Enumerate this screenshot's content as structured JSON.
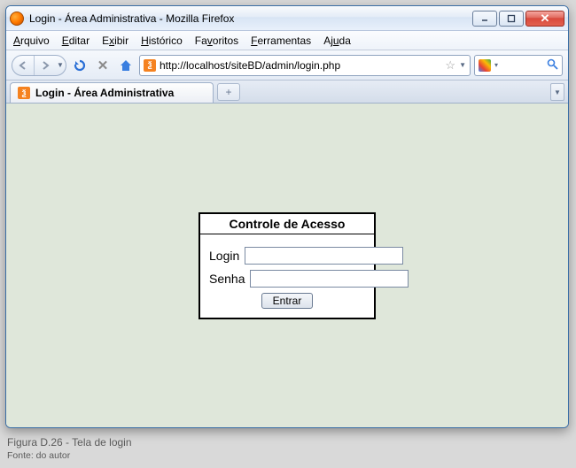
{
  "window": {
    "title": "Login - Área Administrativa - Mozilla Firefox"
  },
  "menu": {
    "arquivo": "Arquivo",
    "editar": "Editar",
    "exibir": "Exibir",
    "historico": "Histórico",
    "favoritos": "Favoritos",
    "ferramentas": "Ferramentas",
    "ajuda": "Ajuda"
  },
  "toolbar": {
    "url": "http://localhost/siteBD/admin/login.php"
  },
  "tab": {
    "label": "Login - Área Administrativa"
  },
  "login": {
    "title": "Controle de Acesso",
    "login_label": "Login",
    "senha_label": "Senha",
    "login_value": "",
    "senha_value": "",
    "submit_label": "Entrar"
  },
  "caption": {
    "line1": "Figura D.26 - Tela de login",
    "line2": "Fonte: do autor"
  }
}
